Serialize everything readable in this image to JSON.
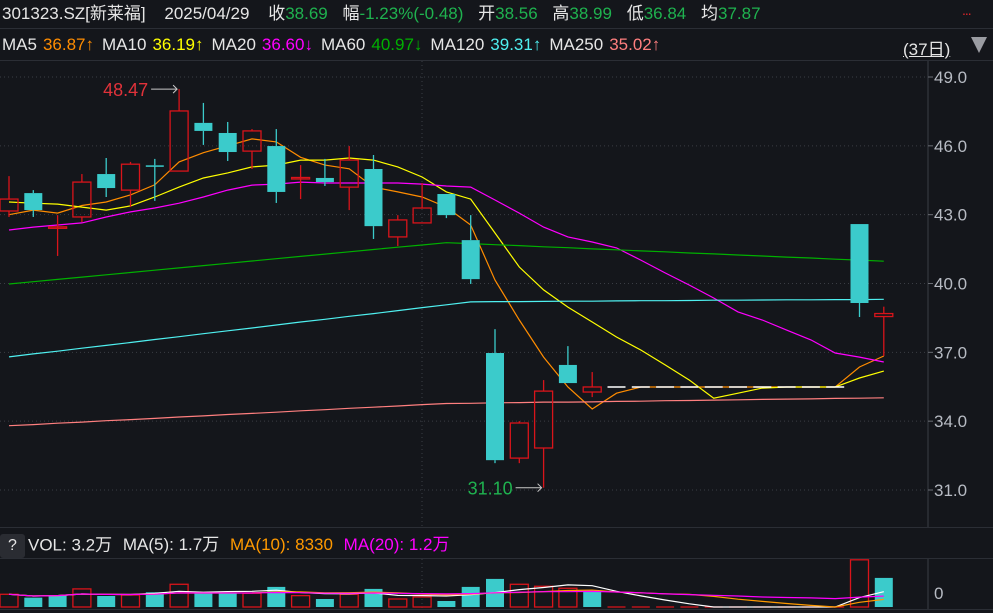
{
  "header": {
    "symbol": "301323.SZ[新莱福]",
    "date": "2025/04/29",
    "close_label": "收",
    "close": "38.69",
    "change_label": "幅",
    "change": "-1.23%(-0.48)",
    "open_label": "开",
    "open": "38.56",
    "high_label": "高",
    "high": "38.99",
    "low_label": "低",
    "low": "36.84",
    "avg_label": "均",
    "avg": "37.87",
    "more": "..."
  },
  "ma_bar": {
    "items": [
      {
        "label": "MA5",
        "value": "36.87↑",
        "color": "#ff8c00"
      },
      {
        "label": "MA10",
        "value": "36.19↑",
        "color": "#ffff00"
      },
      {
        "label": "MA20",
        "value": "36.60↓",
        "color": "#ff00ff"
      },
      {
        "label": "MA60",
        "value": "40.97↓",
        "color": "#00b000"
      },
      {
        "label": "MA120",
        "value": "39.31↑",
        "color": "#4ff0f0"
      },
      {
        "label": "MA250",
        "value": "35.02↑",
        "color": "#ff7f7f"
      }
    ],
    "period": "(37日)"
  },
  "volume_bar": {
    "help": "?",
    "vol": "VOL: 3.2万",
    "ma5": "MA(5): 1.7万",
    "ma10": "MA(10): 8330",
    "ma20": "MA(20): 1.2万"
  },
  "colors": {
    "up": "#d9141b",
    "down": "#3bcbcb",
    "bg": "#14161b"
  },
  "chart_data": {
    "type": "candlestick",
    "ylim": [
      31.0,
      49.0
    ],
    "y_ticks": [
      "49.0",
      "46.0",
      "43.0",
      "40.0",
      "37.0",
      "34.0",
      "31.0"
    ],
    "y_tick_values": [
      49,
      46,
      43,
      40,
      37,
      34,
      31
    ],
    "grid": true,
    "annotations": {
      "high": "48.47",
      "low": "31.10",
      "high_index": 7,
      "low_index": 22
    },
    "candles": [
      [
        43.16,
        44.68,
        42.9,
        43.68
      ],
      [
        43.94,
        44.07,
        42.9,
        43.2
      ],
      [
        42.45,
        42.98,
        41.2,
        42.47
      ],
      [
        42.9,
        44.77,
        42.68,
        44.42
      ],
      [
        44.77,
        45.47,
        43.77,
        44.16
      ],
      [
        44.07,
        45.3,
        43.33,
        45.2
      ],
      [
        45.15,
        45.43,
        43.6,
        45.1
      ],
      [
        44.9,
        48.47,
        44.9,
        47.52
      ],
      [
        47.0,
        47.87,
        46.04,
        46.65
      ],
      [
        46.56,
        47.04,
        45.34,
        45.73
      ],
      [
        45.77,
        46.73,
        44.99,
        46.65
      ],
      [
        45.99,
        46.73,
        43.51,
        43.99
      ],
      [
        44.6,
        45.16,
        43.68,
        44.62
      ],
      [
        44.6,
        45.43,
        44.25,
        44.42
      ],
      [
        44.2,
        45.99,
        43.2,
        45.38
      ],
      [
        44.99,
        45.6,
        41.94,
        42.5
      ],
      [
        42.03,
        42.98,
        41.63,
        42.77
      ],
      [
        42.64,
        44.38,
        42.64,
        43.29
      ],
      [
        43.9,
        43.9,
        42.85,
        42.98
      ],
      [
        41.89,
        42.98,
        39.98,
        40.19
      ],
      [
        36.97,
        38.01,
        32.17,
        32.3
      ],
      [
        32.39,
        34.0,
        32.17,
        33.92
      ],
      [
        32.83,
        35.79,
        31.1,
        35.31
      ],
      [
        36.45,
        37.27,
        35.66,
        35.66
      ],
      [
        35.27,
        36.14,
        35.05,
        35.49
      ],
      null,
      null,
      null,
      null,
      null,
      null,
      null,
      null,
      null,
      null,
      [
        42.59,
        42.59,
        38.54,
        39.15
      ],
      [
        38.56,
        38.99,
        36.84,
        38.69
      ]
    ],
    "halt_price": 35.49,
    "ma_series": [
      {
        "name": "MA5",
        "color": "#ff8c00",
        "values": [
          43.0,
          43.2,
          43.07,
          43.4,
          43.55,
          43.86,
          44.3,
          45.3,
          45.7,
          46.0,
          46.3,
          46.17,
          45.5,
          45.16,
          45.0,
          44.2,
          43.99,
          43.77,
          43.33,
          42.55,
          40.15,
          38.41,
          36.79,
          35.49,
          34.53,
          35.22,
          35.49,
          35.49,
          35.49,
          35.49,
          35.49,
          35.49,
          35.49,
          35.49,
          35.49,
          36.36,
          36.84
        ]
      },
      {
        "name": "MA10",
        "color": "#ffff00",
        "values": [
          43.55,
          43.5,
          43.46,
          43.33,
          43.2,
          43.38,
          43.77,
          44.2,
          44.6,
          44.82,
          45.08,
          45.16,
          45.38,
          45.38,
          45.47,
          45.38,
          45.08,
          44.64,
          43.99,
          43.68,
          42.2,
          40.72,
          39.72,
          38.97,
          38.32,
          37.67,
          37.1,
          36.45,
          35.79,
          35.0,
          35.22,
          35.44,
          35.49,
          35.49,
          35.49,
          35.88,
          36.18
        ]
      },
      {
        "name": "MA20",
        "color": "#ff00ff",
        "values": [
          42.33,
          42.46,
          42.55,
          42.64,
          42.9,
          43.12,
          43.29,
          43.5,
          43.77,
          44.07,
          44.29,
          44.33,
          44.42,
          44.38,
          44.38,
          44.38,
          44.38,
          44.33,
          44.25,
          44.2,
          43.64,
          43.07,
          42.46,
          42.03,
          41.81,
          41.55,
          41.02,
          40.46,
          39.93,
          39.37,
          38.76,
          38.41,
          37.97,
          37.54,
          36.97,
          36.79,
          36.58
        ]
      },
      {
        "name": "MA60",
        "color": "#00b000",
        "values": [
          39.98,
          40.08,
          40.18,
          40.28,
          40.38,
          40.48,
          40.58,
          40.68,
          40.78,
          40.88,
          40.98,
          41.08,
          41.18,
          41.28,
          41.38,
          41.48,
          41.58,
          41.68,
          41.78,
          41.74,
          41.69,
          41.65,
          41.6,
          41.56,
          41.51,
          41.47,
          41.42,
          41.38,
          41.33,
          41.29,
          41.24,
          41.2,
          41.15,
          41.11,
          41.06,
          41.02,
          40.97
        ]
      },
      {
        "name": "MA120",
        "color": "#4ff0f0",
        "values": [
          36.8,
          36.93,
          37.05,
          37.18,
          37.3,
          37.43,
          37.56,
          37.68,
          37.81,
          37.94,
          38.06,
          38.19,
          38.32,
          38.44,
          38.57,
          38.69,
          38.82,
          38.95,
          39.07,
          39.2,
          39.21,
          39.21,
          39.22,
          39.23,
          39.23,
          39.24,
          39.25,
          39.25,
          39.26,
          39.27,
          39.27,
          39.28,
          39.29,
          39.29,
          39.3,
          39.3,
          39.31
        ]
      },
      {
        "name": "MA250",
        "color": "#ff7f7f",
        "values": [
          33.8,
          33.85,
          33.91,
          33.96,
          34.02,
          34.07,
          34.12,
          34.18,
          34.23,
          34.29,
          34.34,
          34.39,
          34.45,
          34.5,
          34.56,
          34.61,
          34.66,
          34.72,
          34.77,
          34.78,
          34.8,
          34.81,
          34.83,
          34.83,
          34.84,
          34.86,
          34.87,
          34.89,
          34.9,
          34.92,
          34.93,
          34.95,
          34.96,
          34.97,
          34.99,
          35.0,
          35.02
        ]
      }
    ],
    "volume_unit": "万",
    "volume_axis_label": "0",
    "volumes": [
      1.4,
      1.03,
      1.32,
      1.99,
      1.21,
      1.32,
      1.62,
      2.5,
      1.51,
      1.51,
      1.51,
      2.21,
      1.25,
      0.88,
      1.4,
      1.99,
      0.88,
      1.1,
      0.66,
      2.21,
      3.09,
      2.5,
      2.28,
      2.06,
      1.77,
      0,
      0,
      0,
      0,
      0,
      0,
      0,
      0,
      0,
      0,
      5.19,
      3.2
    ],
    "volume_dir": [
      "u",
      "d",
      "d",
      "u",
      "d",
      "u",
      "d",
      "u",
      "d",
      "d",
      "u",
      "d",
      "u",
      "d",
      "u",
      "d",
      "u",
      "u",
      "d",
      "d",
      "d",
      "u",
      "u",
      "u",
      "d",
      "u",
      "u",
      "u",
      "u",
      "u",
      "u",
      "u",
      "u",
      "u",
      "u",
      "u",
      "d"
    ]
  }
}
